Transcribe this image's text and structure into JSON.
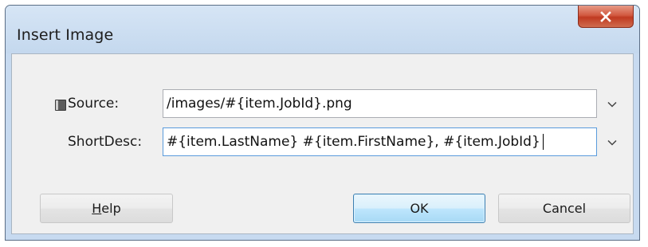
{
  "dialog": {
    "title": "Insert Image"
  },
  "form": {
    "source": {
      "label": "Source:",
      "value": "/images/#{item.JobId}.png"
    },
    "short_desc": {
      "label": "ShortDesc:",
      "value": "#{item.LastName} #{item.FirstName}, #{item.JobId}"
    }
  },
  "buttons": {
    "help": "Help",
    "ok": "OK",
    "cancel": "Cancel"
  },
  "icons": {
    "close": "close-icon",
    "source_indicator": "database-icon",
    "dropdown": "chevron-down-icon"
  }
}
